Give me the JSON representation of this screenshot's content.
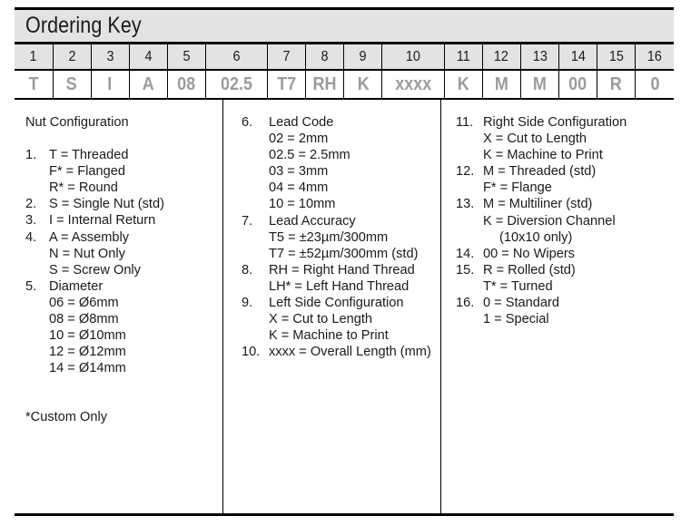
{
  "title": "Ordering Key",
  "colors": {
    "header_fill": "#e3e3e3",
    "value_text": "#9b9b9b",
    "rule": "#000000",
    "body_text": "#1a1a1a"
  },
  "code_table": {
    "positions": [
      "1",
      "2",
      "3",
      "4",
      "5",
      "6",
      "7",
      "8",
      "9",
      "10",
      "11",
      "12",
      "13",
      "14",
      "15",
      "16"
    ],
    "values": [
      "T",
      "S",
      "I",
      "A",
      "08",
      "02.5",
      "T7",
      "RH",
      "K",
      "xxxx",
      "K",
      "M",
      "M",
      "00",
      "R",
      "0"
    ]
  },
  "columns": {
    "left": {
      "heading": "Nut Configuration",
      "entries": [
        {
          "num": "1.",
          "text": "T = Threaded",
          "subs": [
            "F* = Flanged",
            "R* = Round"
          ]
        },
        {
          "num": "2.",
          "text": "S = Single Nut (std)",
          "subs": []
        },
        {
          "num": "3.",
          "text": "I = Internal Return",
          "subs": []
        },
        {
          "num": "4.",
          "text": "A = Assembly",
          "subs": [
            "N = Nut Only",
            "S = Screw Only"
          ]
        },
        {
          "num": "5.",
          "text": "Diameter",
          "subs": [
            "06 = Ø6mm",
            "08 = Ø8mm",
            "10 = Ø10mm",
            "12 = Ø12mm",
            "14 = Ø14mm"
          ]
        }
      ],
      "footnote": "*Custom Only"
    },
    "mid": {
      "entries": [
        {
          "num": "6.",
          "text": "Lead Code",
          "subs": [
            "02 = 2mm",
            "02.5 = 2.5mm",
            "03 = 3mm",
            "04 = 4mm",
            "10 = 10mm"
          ]
        },
        {
          "num": "7.",
          "text": "Lead Accuracy",
          "subs": [
            "T5 = ±23µm/300mm",
            "T7 = ±52µm/300mm (std)"
          ]
        },
        {
          "num": "8.",
          "text": "RH = Right Hand Thread",
          "subs": [
            "LH* = Left Hand Thread"
          ]
        },
        {
          "num": "9.",
          "text": "Left Side Configuration",
          "subs": [
            "X = Cut to Length",
            "K = Machine to Print"
          ]
        },
        {
          "num": "10.",
          "text": "xxxx = Overall Length (mm)",
          "subs": []
        }
      ]
    },
    "right": {
      "entries": [
        {
          "num": "11.",
          "text": "Right Side Configuration",
          "subs": [
            "X = Cut to Length",
            "K = Machine to Print"
          ]
        },
        {
          "num": "12.",
          "text": "M = Threaded (std)",
          "subs": [
            "F* = Flange"
          ]
        },
        {
          "num": "13.",
          "text": "M = Multiliner (std)",
          "subs": [
            "K = Diversion Channel"
          ],
          "deep": [
            "(10x10 only)"
          ]
        },
        {
          "num": "14.",
          "text": "00 = No Wipers",
          "subs": []
        },
        {
          "num": "15.",
          "text": "R = Rolled (std)",
          "subs": [
            "T* = Turned"
          ]
        },
        {
          "num": "16.",
          "text": "0 = Standard",
          "subs": [
            "1 = Special"
          ]
        }
      ]
    }
  }
}
